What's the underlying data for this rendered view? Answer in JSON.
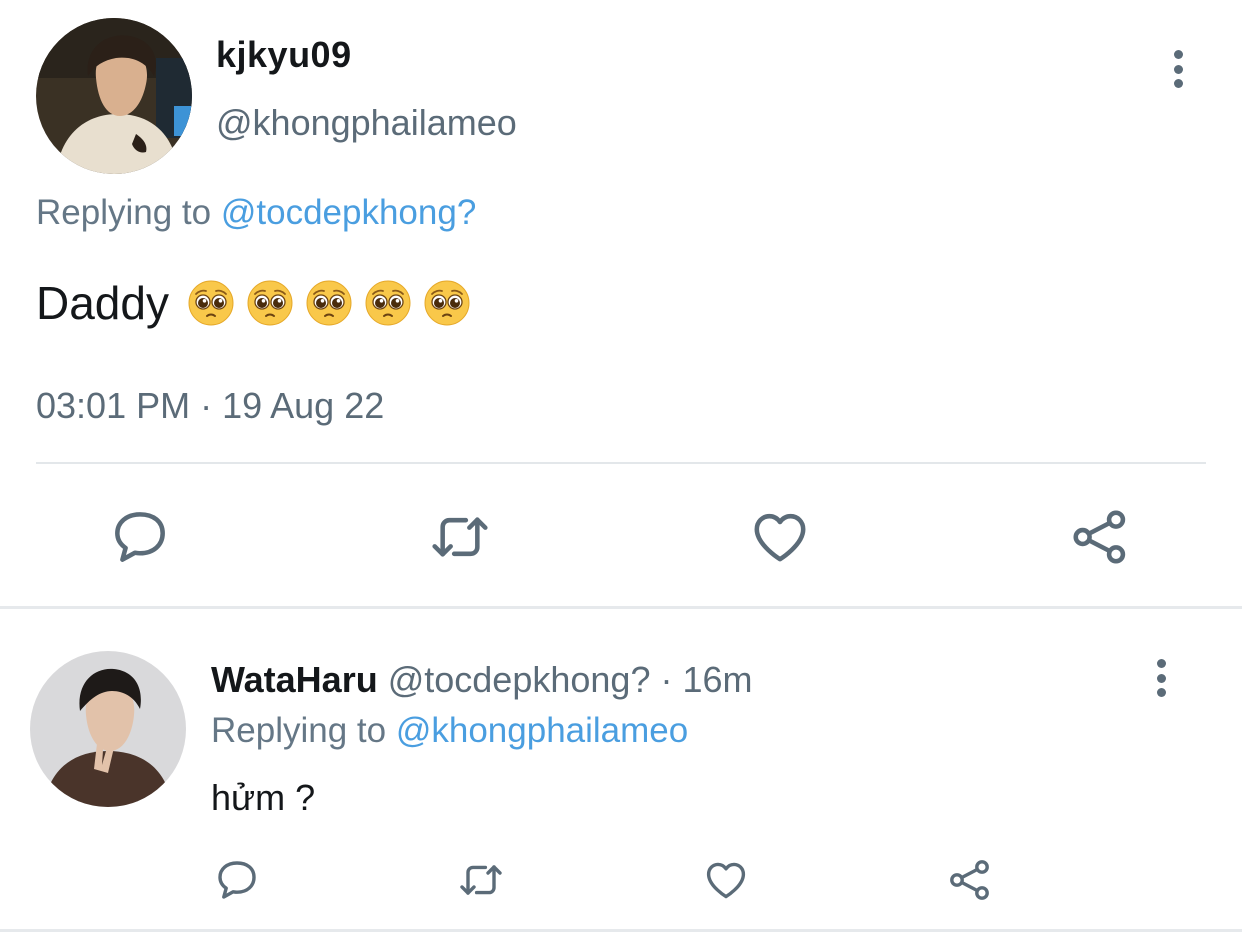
{
  "main_tweet": {
    "display_name": "kjkyu09",
    "handle": "@khongphailameo",
    "replying_prefix": "Replying to",
    "replying_to": "@tocdepkhong?",
    "text": "Daddy",
    "emojis": [
      "pleading-face",
      "pleading-face",
      "pleading-face",
      "pleading-face",
      "pleading-face"
    ],
    "timestamp": "03:01 PM · 19 Aug 22",
    "actions": [
      "reply",
      "retweet",
      "like",
      "share"
    ]
  },
  "reply_tweet": {
    "display_name": "WataHaru",
    "handle": "@tocdepkhong?",
    "separator": " · ",
    "age": "16m",
    "replying_prefix": "Replying to",
    "replying_to": "@khongphailameo",
    "text": "hửm ?",
    "actions": [
      "reply",
      "retweet",
      "like",
      "share"
    ]
  },
  "colors": {
    "text": "#14171a",
    "secondary": "#5b6b78",
    "mention": "#4a9ee0",
    "divider": "#e6e9ec"
  }
}
